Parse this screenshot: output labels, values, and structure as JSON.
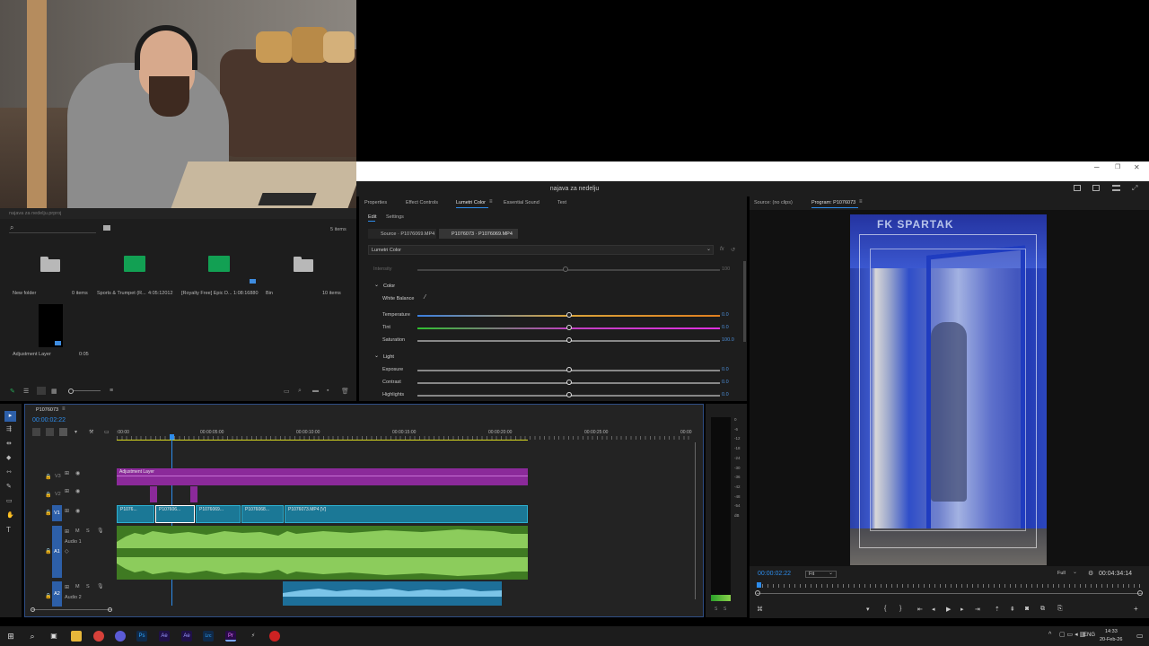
{
  "window": {
    "title": "najava za nedelju",
    "min": "–",
    "restore": "❐",
    "close": "✕"
  },
  "project": {
    "path": "najava za nedelju.prproj",
    "items_count": "5 items",
    "items": [
      {
        "name": "New folder",
        "meta": "0 items",
        "kind": "folder"
      },
      {
        "name": "Sports & Trumpet (R...",
        "meta": "4:05:12012",
        "kind": "audio"
      },
      {
        "name": "[Royalty Free] Epic D...",
        "meta": "1:08:16880",
        "kind": "audio"
      },
      {
        "name": "Bin",
        "meta": "10 items",
        "kind": "folder"
      },
      {
        "name": "Adjustment Layer",
        "meta": "0:05",
        "kind": "adjustment"
      }
    ]
  },
  "effects_panel": {
    "tabs": [
      "Properties",
      "Effect Controls",
      "Lumetri Color",
      "Essential Sound",
      "Text"
    ],
    "active_tab": "Lumetri Color",
    "subtabs": [
      "Edit",
      "Settings"
    ],
    "source_tab": "Source · P1076069.MP4",
    "clip_tab": "P1076073 · P1076069.MP4",
    "effect_name": "Lumetri Color",
    "intensity_label": "Intensity",
    "intensity_value": "100",
    "section_color": "Color",
    "white_balance": "White Balance",
    "section_light": "Light",
    "rows": [
      {
        "label": "Temperature",
        "value": "0.0",
        "knob": 0.5
      },
      {
        "label": "Tint",
        "value": "0.0",
        "knob": 0.5
      },
      {
        "label": "Saturation",
        "value": "100.0",
        "knob": 0.5
      },
      {
        "label": "Exposure",
        "value": "0.0",
        "knob": 0.5
      },
      {
        "label": "Contrast",
        "value": "0.0",
        "knob": 0.5
      },
      {
        "label": "Highlights",
        "value": "0.0",
        "knob": 0.5
      }
    ]
  },
  "monitor": {
    "source_tab": "Source: (no clips)",
    "program_tab": "Program: P1076073",
    "timecode": "00:00:02:22",
    "fit": "Fit",
    "quality": "Full",
    "duration": "00:04:34:14",
    "sign_text": "FK SPARTAK"
  },
  "timeline": {
    "sequence": "P1076073",
    "timecode": "00:00:02:22",
    "ruler": [
      ":00:00",
      "00:00:05:00",
      "00:00:10:00",
      "00:00:15:00",
      "00:00:20:00",
      "00:00:25:00",
      "00:00"
    ],
    "tracks": {
      "v3": "V3",
      "v2": "V2",
      "v1": "V1",
      "a1": "A1",
      "a2": "A2",
      "audio1": "Audio 1",
      "audio2": "Audio 2"
    },
    "clips": {
      "adjustment": "Adjustment Layer",
      "v1a": "P1076...",
      "v1b": "P107606...",
      "v1c": "P1076069...",
      "v1d": "P1076068...",
      "v1e": "P1076073.MP4 [V]"
    }
  },
  "meter": {
    "labels": [
      "0",
      "-6",
      "-12",
      "-18",
      "-24",
      "-30",
      "-36",
      "-42",
      "-48",
      "-54",
      "dB"
    ],
    "s": "S",
    "s2": "S"
  },
  "taskbar": {
    "lang": "ENG",
    "time": "14:33",
    "date": "20-Feb-26",
    "apps": [
      "Ps",
      "Ae",
      "Ae",
      "Lrc",
      "Pr"
    ]
  },
  "colors": {
    "accent": "#2d8ceb",
    "adjustment": "#8b2a9a",
    "video_clip": "#1b7896",
    "audio_clip": "#5da534",
    "audio2_clip": "#1d6f99"
  }
}
